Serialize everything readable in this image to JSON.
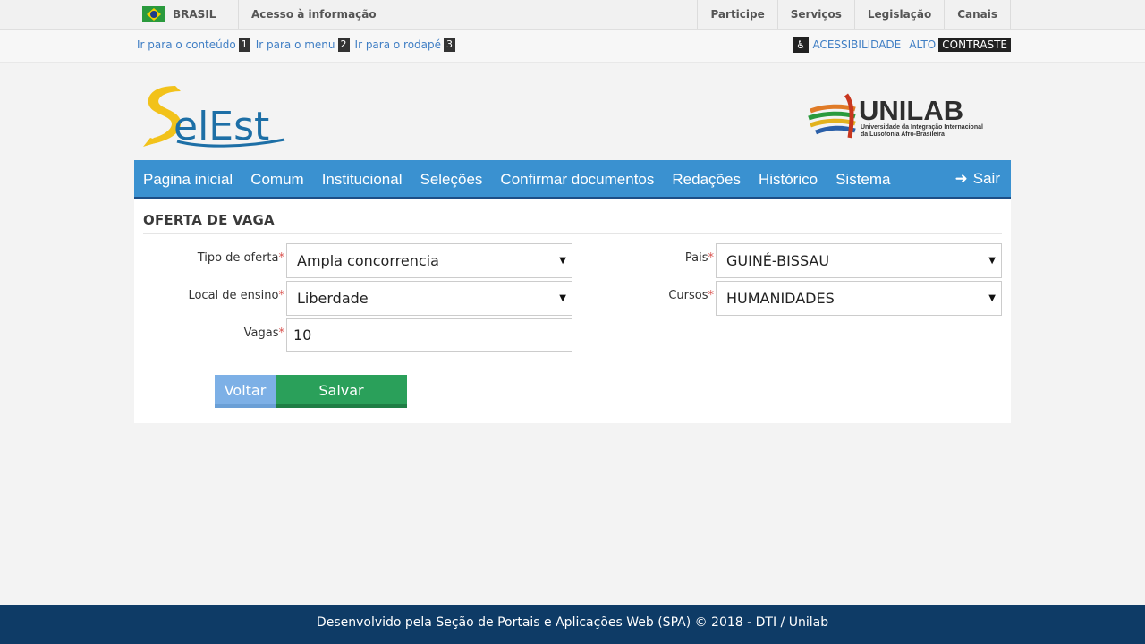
{
  "govbar": {
    "country": "BRASIL",
    "access_info": "Acesso à informação",
    "links": [
      "Participe",
      "Serviços",
      "Legislação",
      "Canais"
    ]
  },
  "accbar": {
    "skip": [
      {
        "label": "Ir para o conteúdo",
        "key": "1"
      },
      {
        "label": "Ir para o menu",
        "key": "2"
      },
      {
        "label": "Ir para o rodapé",
        "key": "3"
      }
    ],
    "accessibility": "ACESSIBILIDADE",
    "alto": "ALTO",
    "contraste": "CONTRASTE"
  },
  "header": {
    "unilab_word": "UNILAB",
    "unilab_sub_line1": "Universidade da Integração Internacional",
    "unilab_sub_line2": "da Lusofonia Afro-Brasileira"
  },
  "nav": {
    "items": [
      "Pagina inicial",
      "Comum",
      "Institucional",
      "Seleções",
      "Confirmar documentos",
      "Redações",
      "Histórico",
      "Sistema"
    ],
    "logout": "Sair"
  },
  "form": {
    "title": "OFERTA DE VAGA",
    "tipo_label": "Tipo de oferta",
    "tipo_value": "Ampla concorrencia",
    "local_label": "Local de ensino",
    "local_value": "Liberdade",
    "vagas_label": "Vagas",
    "vagas_value": "10",
    "pais_label": "Pais",
    "pais_value": "GUINÉ-BISSAU",
    "cursos_label": "Cursos",
    "cursos_value": "HUMANIDADES",
    "required_mark": "*",
    "back_button": "Voltar",
    "save_button": "Salvar"
  },
  "footer": {
    "text": "Desenvolvido pela Seção de Portais e Aplicações Web (SPA) © 2018 - DTI / Unilab"
  },
  "colors": {
    "nav_bg": "#3a91d0",
    "nav_border": "#1c4e86",
    "save_btn": "#2aa05a",
    "back_btn": "#7db0e6",
    "footer_bg": "#0e3b66",
    "required": "#d9534f"
  },
  "icons": {
    "flag": "brazil-flag-icon",
    "accessibility": "wheelchair-icon",
    "logout": "arrow-right-icon",
    "select": "caret-down-icon"
  }
}
